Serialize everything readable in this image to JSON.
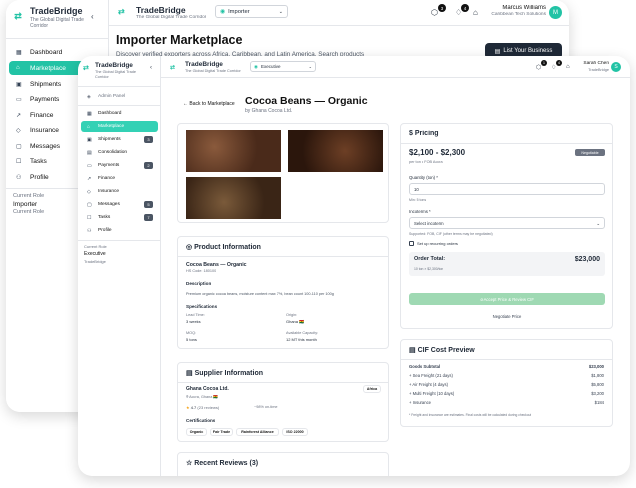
{
  "back": {
    "brand": "TradeBridge",
    "tagline": "The Global Digital Trade Corridor",
    "role_select": "Importer",
    "notif_count_1": "3",
    "notif_count_2": "4",
    "user_name": "Marcus Williams",
    "user_company": "Caribbean Tech Solutions",
    "avatar": "M",
    "page_title": "Importer Marketplace",
    "page_subtitle": "Discover verified exporters across Africa, Caribbean, and Latin America. Search products",
    "list_button": "List Your Business",
    "nav": [
      "Dashboard",
      "Marketplace",
      "Shipments",
      "Payments",
      "Finance",
      "Insurance",
      "Messages",
      "Tasks",
      "Profile"
    ],
    "role_label": "Current Role",
    "role_value": "Importer",
    "role_label2": "Current Role"
  },
  "front": {
    "brand": "TradeBridge",
    "tagline": "The Global Digital Trade Corridor",
    "role_select": "Executive",
    "notif_count_1": "1",
    "notif_count_2": "4",
    "user_name": "Sarah Chen",
    "user_company": "TradeBridge",
    "avatar": "S",
    "admin_panel": "Admin Panel",
    "nav": [
      {
        "label": "Dashboard",
        "count": ""
      },
      {
        "label": "Marketplace",
        "count": ""
      },
      {
        "label": "Shipments",
        "count": "3"
      },
      {
        "label": "Consolidation",
        "count": ""
      },
      {
        "label": "Payments",
        "count": "2"
      },
      {
        "label": "Finance",
        "count": ""
      },
      {
        "label": "Insurance",
        "count": ""
      },
      {
        "label": "Messages",
        "count": "5"
      },
      {
        "label": "Tasks",
        "count": "7"
      },
      {
        "label": "Profile",
        "count": ""
      }
    ],
    "role_label": "Current Role",
    "role_value": "Executive",
    "role_org": "TradeBridge",
    "back_link": "Back to Marketplace",
    "product_title": "Cocoa Beans — Organic",
    "product_by": "by Ghana Cocoa Ltd.",
    "info": {
      "heading": "Product Information",
      "name": "Cocoa Beans — Organic",
      "hs": "HS Code: 180100",
      "desc_h": "Description",
      "desc": "Premium organic cocoa beans, moisture content max 7%, bean count 100-110 per 100g",
      "spec_h": "Specifications",
      "lead_l": "Lead Time:",
      "lead_v": "3 weeks",
      "origin_l": "Origin:",
      "origin_v": "Ghana 🇬🇭",
      "moq_l": "MOQ:",
      "moq_v": "5 tons",
      "cap_l": "Available Capacity:",
      "cap_v": "12 MT this month"
    },
    "supplier": {
      "heading": "Supplier Information",
      "name": "Ghana Cocoa Ltd.",
      "region": "Africa",
      "loc": "Accra, Ghana 🇬🇭",
      "rating": "4.7",
      "reviews": "(23 reviews)",
      "ontime": "~98% on-time",
      "cert_h": "Certifications",
      "certs": [
        "Organic",
        "Fair Trade",
        "Rainforest Alliance",
        "ISO 22000"
      ]
    },
    "reviews_heading": "Recent Reviews (3)",
    "pricing": {
      "heading": "Pricing",
      "price": "$2,100 - $2,300",
      "badge": "Negotiable",
      "unit": "per ton • FOB Accra",
      "qty_label": "Quantity (ton) *",
      "qty_value": "10",
      "qty_hint": "Min: 5 tons",
      "inco_label": "Incoterms *",
      "inco_value": "Select incoterm",
      "inco_hint": "Supported: FOB, CIF (other terms may be negotiated)",
      "recurring": "Set up recurring orders",
      "total_label": "Order Total:",
      "total_value": "$23,000",
      "total_sub": "10 ton × $2,300/ton",
      "accept": "Accept Price & Review CIF",
      "negotiate": "Negotiate Price"
    },
    "cif": {
      "heading": "CIF Cost Preview",
      "rows": [
        {
          "label": "Goods Subtotal",
          "value": "$23,000"
        },
        {
          "label": "+ Sea Freight (21 days)",
          "value": "$1,800"
        },
        {
          "label": "+ Air Freight (4 days)",
          "value": "$5,800"
        },
        {
          "label": "+ Multi Freight (10 days)",
          "value": "$3,200"
        },
        {
          "label": "+ Insurance",
          "value": "$184"
        }
      ],
      "note": "* Freight and insurance are estimates. Final costs will be calculated during checkout"
    }
  },
  "colors": {
    "accent": "#22c3a5",
    "dark": "#1f2937",
    "muted": "#6b7280"
  }
}
